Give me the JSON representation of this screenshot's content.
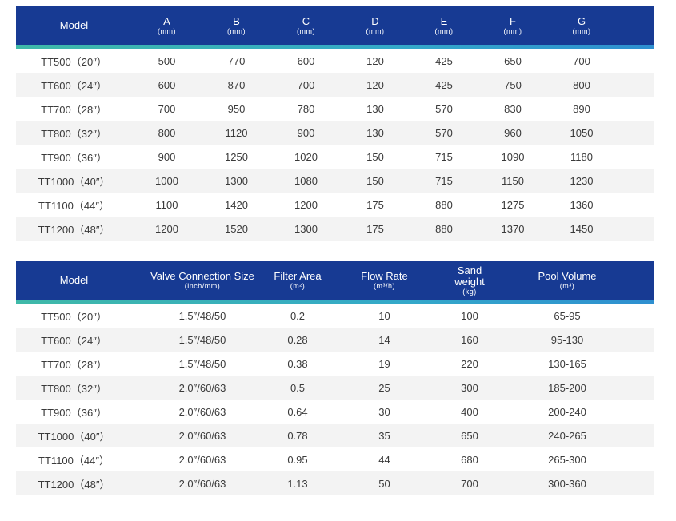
{
  "dimensions_table": {
    "headers": [
      {
        "label": "Model",
        "unit": ""
      },
      {
        "label": "A",
        "unit": "(mm)"
      },
      {
        "label": "B",
        "unit": "(mm)"
      },
      {
        "label": "C",
        "unit": "(mm)"
      },
      {
        "label": "D",
        "unit": "(mm)"
      },
      {
        "label": "E",
        "unit": "(mm)"
      },
      {
        "label": "F",
        "unit": "(mm)"
      },
      {
        "label": "G",
        "unit": "(mm)"
      }
    ],
    "rows": [
      [
        "TT500（20″）",
        "500",
        "770",
        "600",
        "120",
        "425",
        "650",
        "700"
      ],
      [
        "TT600（24″）",
        "600",
        "870",
        "700",
        "120",
        "425",
        "750",
        "800"
      ],
      [
        "TT700（28″）",
        "700",
        "950",
        "780",
        "130",
        "570",
        "830",
        "890"
      ],
      [
        "TT800（32″）",
        "800",
        "1120",
        "900",
        "130",
        "570",
        "960",
        "1050"
      ],
      [
        "TT900（36″）",
        "900",
        "1250",
        "1020",
        "150",
        "715",
        "1090",
        "1180"
      ],
      [
        "TT1000（40″）",
        "1000",
        "1300",
        "1080",
        "150",
        "715",
        "1150",
        "1230"
      ],
      [
        "TT1100（44″）",
        "1100",
        "1420",
        "1200",
        "175",
        "880",
        "1275",
        "1360"
      ],
      [
        "TT1200（48″）",
        "1200",
        "1520",
        "1300",
        "175",
        "880",
        "1370",
        "1450"
      ]
    ]
  },
  "performance_table": {
    "headers": [
      {
        "label": "Model",
        "unit": ""
      },
      {
        "label": "Valve Connection Size",
        "unit": "(inch/mm)"
      },
      {
        "label": "Filter Area",
        "unit": "(m²)"
      },
      {
        "label": "Flow Rate",
        "unit": "(m³/h)"
      },
      {
        "label": "Sand weight",
        "unit": "(kg)"
      },
      {
        "label": "Pool Volume",
        "unit": "(m³)"
      }
    ],
    "rows": [
      [
        "TT500（20″）",
        "1.5″/48/50",
        "0.2",
        "10",
        "100",
        "65-95"
      ],
      [
        "TT600（24″）",
        "1.5″/48/50",
        "0.28",
        "14",
        "160",
        "95-130"
      ],
      [
        "TT700（28″）",
        "1.5″/48/50",
        "0.38",
        "19",
        "220",
        "130-165"
      ],
      [
        "TT800（32″）",
        "2.0″/60/63",
        "0.5",
        "25",
        "300",
        "185-200"
      ],
      [
        "TT900（36″）",
        "2.0″/60/63",
        "0.64",
        "30",
        "400",
        "200-240"
      ],
      [
        "TT1000（40″）",
        "2.0″/60/63",
        "0.78",
        "35",
        "650",
        "240-265"
      ],
      [
        "TT1100（44″）",
        "2.0″/60/63",
        "0.95",
        "44",
        "680",
        "265-300"
      ],
      [
        "TT1200（48″）",
        "2.0″/60/63",
        "1.13",
        "50",
        "700",
        "300-360"
      ]
    ]
  },
  "colors": {
    "header_bg": "#173a93",
    "header_text": "#ffffff",
    "stripe_start": "#3fb9a8",
    "stripe_end": "#2e8fd0",
    "row_alt_bg": "#f3f3f3",
    "body_text": "#3a3a3a"
  }
}
